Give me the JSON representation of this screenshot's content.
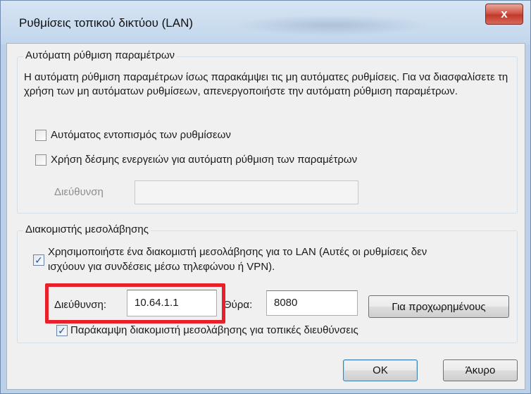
{
  "window": {
    "title": "Ρυθμίσεις τοπικού δικτύου (LAN)",
    "close_label": "x"
  },
  "auto_config": {
    "legend": "Αυτόματη ρύθμιση παραμέτρων",
    "description": "Η αυτόματη ρύθμιση παραμέτρων ίσως παρακάμψει τις μη αυτόματες ρυθμίσεις. Για να διασφαλίσετε τη χρήση των μη αυτόματων ρυθμίσεων, απενεργοποιήστε την αυτόματη ρύθμιση παραμέτρων.",
    "auto_detect_label": "Αυτόματος εντοπισμός των ρυθμίσεων",
    "auto_detect_checked": false,
    "use_script_label": "Χρήση δέσμης ενεργειών για αυτόματη ρύθμιση των παραμέτρων",
    "use_script_checked": false,
    "address_label": "Διεύθυνση",
    "address_value": ""
  },
  "proxy": {
    "legend": "Διακομιστής μεσολάβησης",
    "use_proxy_label_line1": "Χρησιμοποιήστε ένα διακομιστή μεσολάβησης για το LAN (Αυτές οι ρυθμίσεις δεν",
    "use_proxy_label_line2": "ισχύουν για συνδέσεις μέσω τηλεφώνου ή VPN).",
    "use_proxy_checked": true,
    "address_label": "Διεύθυνση:",
    "address_value": "10.64.1.1",
    "port_label": "Θύρα:",
    "port_value": "8080",
    "advanced_label": "Για προχωρημένους",
    "bypass_label": "Παράκαμψη διακομιστή μεσολάβησης για τοπικές διευθύνσεις",
    "bypass_checked": true
  },
  "buttons": {
    "ok": "OK",
    "cancel": "Άκυρο"
  },
  "colors": {
    "highlight": "#e8202a",
    "close_button": "#c0392b"
  }
}
